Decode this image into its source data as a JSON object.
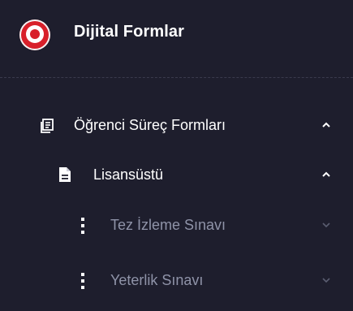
{
  "app": {
    "title": "Dijital Formlar"
  },
  "colors": {
    "background": "#1e1e2d",
    "active_text": "#ffffff",
    "muted_text": "#8f93a8",
    "brand_red": "#d8202a"
  },
  "menu": {
    "items": [
      {
        "label": "Öğrenci Süreç Formları",
        "icon": "document-copy-icon",
        "chevron": "chevron-up-icon",
        "expanded": true
      },
      {
        "label": "Lisansüstü",
        "icon": "document-icon",
        "chevron": "chevron-up-icon",
        "expanded": true
      },
      {
        "label": "Tez İzleme Sınavı",
        "icon": "vertical-dots-icon",
        "chevron": "chevron-down-icon",
        "expanded": false
      },
      {
        "label": "Yeterlik Sınavı",
        "icon": "vertical-dots-icon",
        "chevron": "chevron-down-icon",
        "expanded": false
      }
    ]
  }
}
